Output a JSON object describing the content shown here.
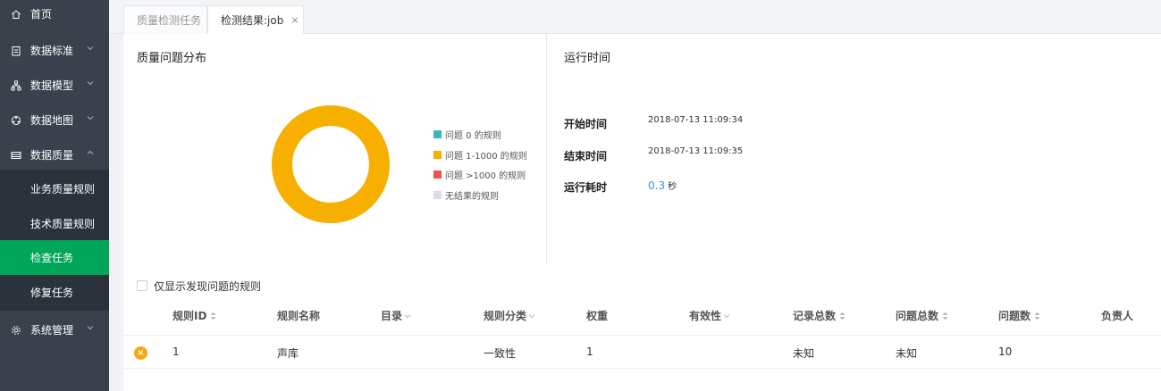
{
  "sidebar": {
    "items": [
      {
        "label": "首页",
        "icon": "home-icon"
      },
      {
        "label": "数据标准",
        "icon": "clipboard-icon"
      },
      {
        "label": "数据模型",
        "icon": "hierarchy-icon"
      },
      {
        "label": "数据地图",
        "icon": "map-icon"
      },
      {
        "label": "数据质量",
        "icon": "database-icon"
      },
      {
        "label": "系统管理",
        "icon": "gear-icon"
      }
    ],
    "submenu": [
      {
        "label": "业务质量规则"
      },
      {
        "label": "技术质量规则"
      },
      {
        "label": "检查任务",
        "active": true
      },
      {
        "label": "修复任务"
      }
    ]
  },
  "tabs": [
    {
      "label": "质量检测任务"
    },
    {
      "label": "检测结果:job",
      "close": "×",
      "active": true
    }
  ],
  "distribution": {
    "title": "质量问题分布",
    "legend": [
      {
        "label": "问题 0 的规则",
        "color": "#3cb6c3"
      },
      {
        "label": "问题 1-1000 的规则",
        "color": "#f7af00"
      },
      {
        "label": "问题 >1000 的规则",
        "color": "#ef5350"
      },
      {
        "label": "无结果的规则",
        "color": "#d9dde6"
      }
    ],
    "slices": [
      0,
      1,
      0,
      0
    ]
  },
  "runtime": {
    "title": "运行时间",
    "start_label": "开始时间",
    "start_value": "2018-07-13 11:09:34",
    "end_label": "结束时间",
    "end_value": "2018-07-13 11:09:35",
    "duration_label": "运行耗时",
    "duration_value": "0.3",
    "duration_unit": "秒"
  },
  "filter": {
    "checkbox_label": "仅显示发现问题的规则",
    "checked": false
  },
  "table": {
    "headers": {
      "rule_id": "规则ID",
      "rule_name": "规则名称",
      "catalog": "目录",
      "category": "规则分类",
      "weight": "权重",
      "validity": "有效性",
      "total_records": "记录总数",
      "total_issues": "问题总数",
      "issue_count": "问题数",
      "owner": "负责人"
    },
    "rows": [
      {
        "status": "×",
        "rule_id": "1",
        "rule_name": "声库",
        "catalog": "",
        "category": "一致性",
        "weight": "1",
        "validity": "",
        "total_records": "未知",
        "total_issues": "未知",
        "issue_count": "10",
        "owner": ""
      }
    ]
  }
}
